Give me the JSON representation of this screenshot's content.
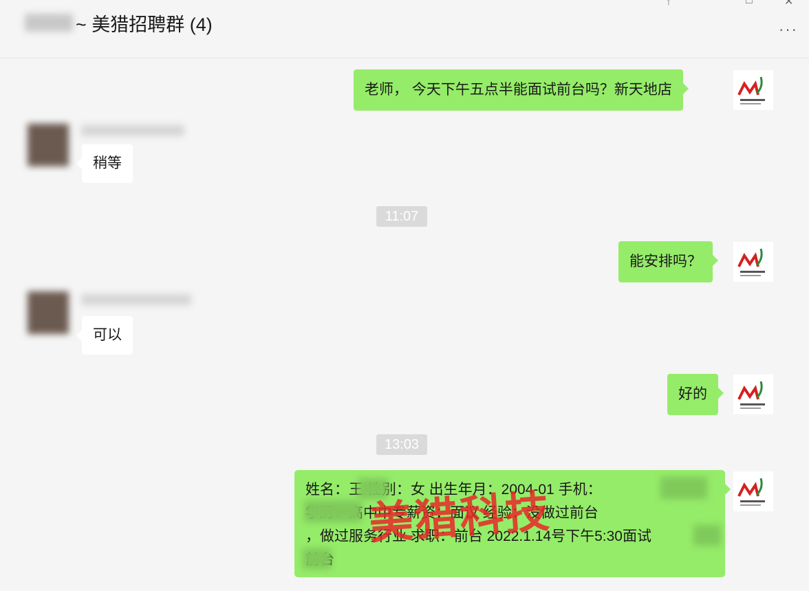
{
  "header": {
    "title": "~ 美猎招聘群 (4)",
    "more_label": "···",
    "pin_icon": "pin-icon",
    "minimize_icon": "minimize-icon",
    "maximize_icon": "maximize-icon",
    "close_icon": "close-icon"
  },
  "messages": [
    {
      "sender": "me",
      "text": "老师， 今天下午五点半能面试前台吗？新天地店"
    },
    {
      "sender": "other",
      "text": "稍等"
    },
    {
      "time": "11:07"
    },
    {
      "sender": "me",
      "text": "能安排吗？"
    },
    {
      "sender": "other",
      "text": "可以"
    },
    {
      "sender": "me",
      "text": "好的"
    },
    {
      "time": "13:03"
    },
    {
      "sender": "me",
      "lines": [
        "姓名：王   性别：女 出生年月：2004-01 手机：",
        "          学历：高中中专薪资：面议 经验：没做过前台",
        "，做过服务行业 求职：前台 2022.1.14号下午5:30面试",
        "   前台"
      ]
    }
  ],
  "watermark": "美猎科技",
  "colors": {
    "me_bubble": "#95ec69",
    "other_bubble": "#ffffff",
    "background": "#f5f5f5"
  }
}
